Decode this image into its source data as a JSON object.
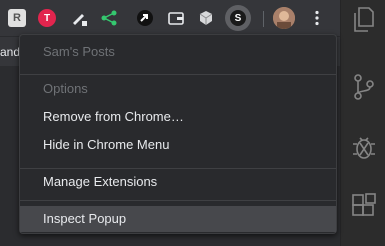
{
  "toolbar": {
    "extensions": [
      {
        "icon": "r-logo-icon",
        "letter": "R"
      },
      {
        "icon": "red-shield-icon",
        "letter": "T"
      },
      {
        "icon": "pencil-icon"
      },
      {
        "icon": "share-icon"
      },
      {
        "icon": "arrow-icon"
      },
      {
        "icon": "wallet-icon"
      },
      {
        "icon": "cube-icon"
      },
      {
        "icon": "s-extension-icon",
        "letter": "S"
      },
      {
        "icon": "profile-avatar"
      },
      {
        "icon": "more-vert-icon"
      }
    ]
  },
  "bookmark_bar": {
    "partial_text": "and"
  },
  "context_menu": {
    "title": "Sam's Posts",
    "options_heading": "Options",
    "remove_label": "Remove from Chrome…",
    "hide_label": "Hide in Chrome Menu",
    "manage_label": "Manage Extensions",
    "inspect_label": "Inspect Popup"
  },
  "activity_bar": {
    "icons": [
      "copy-icon",
      "source-control-icon",
      "debug-icon",
      "extensions-icon"
    ]
  },
  "colors": {
    "menu_bg": "#292a2d",
    "highlight": "#47484c",
    "text": "#e8eaed",
    "disabled_text": "#6f7276"
  }
}
